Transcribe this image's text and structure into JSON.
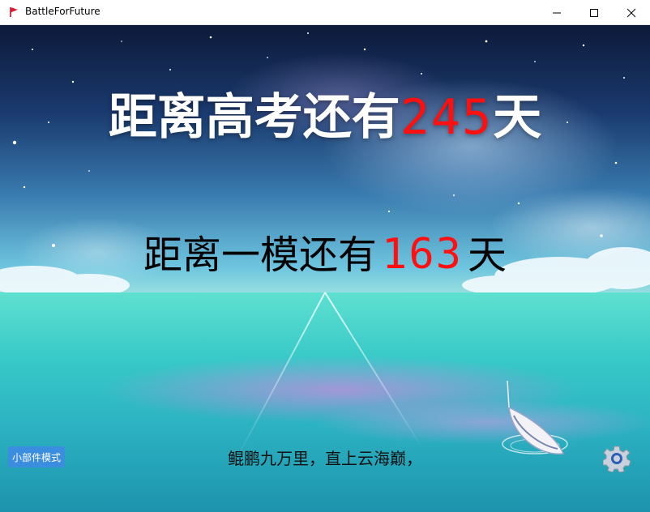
{
  "window": {
    "title": "BattleForFuture"
  },
  "countdown_main": {
    "prefix": "距离高考还有",
    "days": "245",
    "suffix": "天"
  },
  "countdown_sub": {
    "prefix": "距离一模还有",
    "days": "163",
    "suffix": "天"
  },
  "widget_button": {
    "label": "小部件模式"
  },
  "motto": "鲲鹏九万里，直上云海巅，",
  "icons": {
    "app": "app-flag-icon",
    "settings": "gear-icon",
    "minimize": "minimize-icon",
    "maximize": "maximize-icon",
    "close": "close-icon"
  },
  "colors": {
    "countdown_digits": "#ff1010",
    "widget_button": "#3b8de0",
    "headline": "#ffffff"
  }
}
